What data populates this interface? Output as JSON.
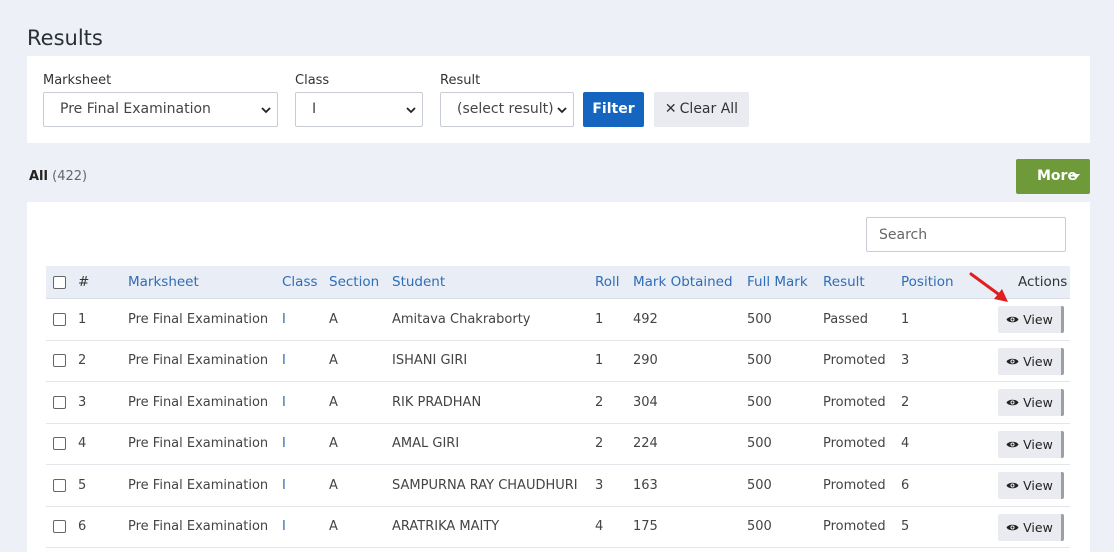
{
  "page": {
    "title": "Results"
  },
  "filters": {
    "marksheet": {
      "label": "Marksheet",
      "value": "Pre Final Examination"
    },
    "class": {
      "label": "Class",
      "value": "I"
    },
    "result": {
      "label": "Result",
      "value": "(select result)"
    },
    "filter_button": "Filter",
    "clear_button": "Clear All",
    "clear_icon": "close-icon"
  },
  "summary": {
    "all_label": "All",
    "all_count": "(422)"
  },
  "more_button": "More",
  "search": {
    "placeholder": "Search"
  },
  "table": {
    "headers": {
      "index": "#",
      "marksheet": "Marksheet",
      "class": "Class",
      "section": "Section",
      "student": "Student",
      "roll": "Roll",
      "mark_obtained": "Mark Obtained",
      "full_mark": "Full Mark",
      "result": "Result",
      "position": "Position",
      "actions": "Actions"
    },
    "view_label": "View",
    "view_icon": "eye-icon",
    "rows": [
      {
        "index": "1",
        "marksheet": "Pre Final Examination",
        "class": "I",
        "section": "A",
        "student": "Amitava Chakraborty",
        "roll": "1",
        "mark_obtained": "492",
        "full_mark": "500",
        "result": "Passed",
        "position": "1"
      },
      {
        "index": "2",
        "marksheet": "Pre Final Examination",
        "class": "I",
        "section": "A",
        "student": "ISHANI GIRI",
        "roll": "1",
        "mark_obtained": "290",
        "full_mark": "500",
        "result": "Promoted",
        "position": "3"
      },
      {
        "index": "3",
        "marksheet": "Pre Final Examination",
        "class": "I",
        "section": "A",
        "student": "RIK PRADHAN",
        "roll": "2",
        "mark_obtained": "304",
        "full_mark": "500",
        "result": "Promoted",
        "position": "2"
      },
      {
        "index": "4",
        "marksheet": "Pre Final Examination",
        "class": "I",
        "section": "A",
        "student": "AMAL GIRI",
        "roll": "2",
        "mark_obtained": "224",
        "full_mark": "500",
        "result": "Promoted",
        "position": "4"
      },
      {
        "index": "5",
        "marksheet": "Pre Final Examination",
        "class": "I",
        "section": "A",
        "student": "SAMPURNA RAY CHAUDHURI",
        "roll": "3",
        "mark_obtained": "163",
        "full_mark": "500",
        "result": "Promoted",
        "position": "6"
      },
      {
        "index": "6",
        "marksheet": "Pre Final Examination",
        "class": "I",
        "section": "A",
        "student": "ARATRIKA MAITY",
        "roll": "4",
        "mark_obtained": "175",
        "full_mark": "500",
        "result": "Promoted",
        "position": "5"
      }
    ]
  },
  "colors": {
    "primary": "#1565c0",
    "more": "#6f9a3a",
    "link": "#2f6db8",
    "annotation_arrow": "#e02020"
  }
}
